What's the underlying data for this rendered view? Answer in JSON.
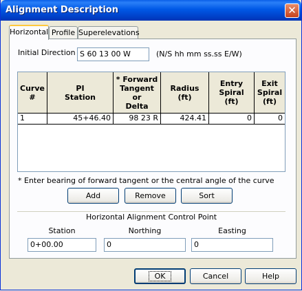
{
  "dialog": {
    "title": "Alignment Description",
    "close_glyph": "✕"
  },
  "tabs": [
    {
      "label": "Horizontal",
      "active": true
    },
    {
      "label": "Profile",
      "active": false
    },
    {
      "label": "Superelevations",
      "active": false
    }
  ],
  "initial_direction": {
    "label": "Initial Direction",
    "value": "S 60 13 00 W",
    "format_hint": "(N/S hh mm ss.ss E/W)"
  },
  "curve_table": {
    "headers": [
      "Curve\n#",
      "PI\nStation",
      "* Forward\nTangent\nor\nDelta",
      "Radius\n(ft)",
      "Entry\nSpiral\n(ft)",
      "Exit\nSpiral\n(ft)"
    ],
    "rows": [
      [
        "1",
        "45+46.40",
        "98 23 R",
        "424.41",
        "0",
        "0"
      ]
    ]
  },
  "footnote": "* Enter bearing of forward tangent or the central angle of the curve",
  "table_buttons": {
    "add": "Add",
    "remove": "Remove",
    "sort": "Sort"
  },
  "control_point": {
    "group_title": "Horizontal Alignment Control Point",
    "station_label": "Station",
    "station_value": "0+00.00",
    "northing_label": "Northing",
    "northing_value": "0",
    "easting_label": "Easting",
    "easting_value": "0"
  },
  "footer_buttons": {
    "ok": "OK",
    "cancel": "Cancel",
    "help": "Help"
  },
  "colors": {
    "titlebar": "#0058e6",
    "dialog_bg": "#ece9d8",
    "tab_highlight": "#ffc83c",
    "close_button": "#c7421d"
  }
}
